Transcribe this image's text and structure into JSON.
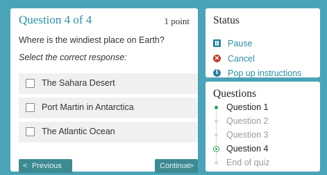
{
  "question": {
    "title": "Question 4 of 4",
    "points": "1 point",
    "text": "Where is the windiest place on Earth?",
    "instruction": "Select the correct response:",
    "options": [
      {
        "label": "The Sahara Desert",
        "checked": false
      },
      {
        "label": "Port Martin in Antarctica",
        "checked": false
      },
      {
        "label": "The Atlantic Ocean",
        "checked": false
      }
    ],
    "previous_label": "Previous",
    "continue_label": "Continue",
    "previous_chevron": "<",
    "continue_chevron": ">"
  },
  "status": {
    "title": "Status",
    "items": [
      {
        "label": "Pause",
        "icon": "pause-icon"
      },
      {
        "label": "Cancel",
        "icon": "cancel-icon"
      },
      {
        "label": "Pop up instructions",
        "icon": "info-icon"
      }
    ]
  },
  "questions_nav": {
    "title": "Questions",
    "items": [
      {
        "label": "Question 1",
        "state": "answered"
      },
      {
        "label": "Question 2",
        "state": "unanswered"
      },
      {
        "label": "Question 3",
        "state": "unanswered"
      },
      {
        "label": "Question 4",
        "state": "current"
      },
      {
        "label": "End of quiz",
        "state": "unanswered"
      }
    ]
  },
  "colors": {
    "background": "#4aa3b7",
    "accent": "#2a8ea0",
    "button": "#3e8a93",
    "answered": "#2e9d5c",
    "cancel": "#c0392b"
  }
}
